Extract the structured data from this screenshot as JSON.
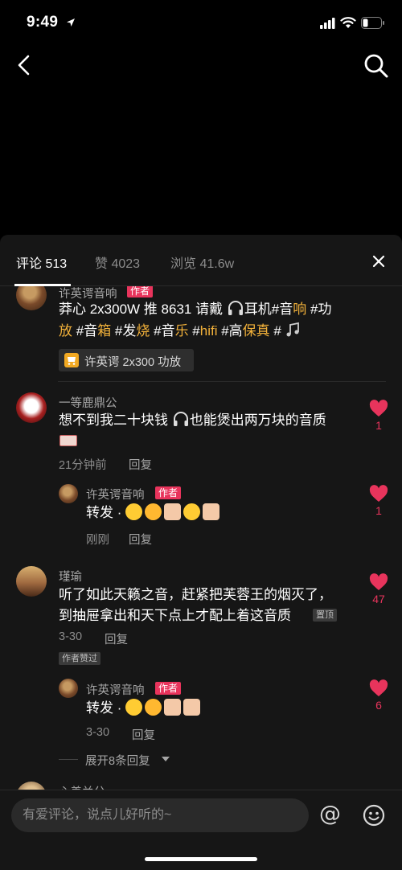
{
  "status_bar": {
    "time": "9:49"
  },
  "colors": {
    "accent": "#e8345c",
    "gold_text": "#f2b13a",
    "sheet_bg": "#161616"
  },
  "tabs": [
    {
      "label": "评论 513",
      "active": true
    },
    {
      "label": "赞 4023",
      "active": false
    },
    {
      "label": "浏览 41.6w",
      "active": false
    }
  ],
  "comments": {
    "c0": {
      "username": "许英谔音响",
      "badge": "作者",
      "line1": [
        "莽心 2x300W 推 8631 请戴",
        "耳机#音",
        "响",
        " #功"
      ],
      "line2": [
        "放",
        " #音",
        "箱",
        " #发",
        "烧",
        " #音",
        "乐",
        " #",
        "hifi",
        " #高",
        "保真",
        " #"
      ],
      "product": "许英谔 2x300 功放"
    },
    "c1": {
      "username": "一等鹿鼎公",
      "text_a": "想不到我二十块钱",
      "text_b": "也能煲出两万块的音质",
      "time": "21分钟前",
      "reply": "回复",
      "likes": "1"
    },
    "c1r": {
      "username": "许英谔音响",
      "badge": "作者",
      "text": "转发 ·",
      "time": "刚刚",
      "reply": "回复",
      "likes": "1"
    },
    "c2": {
      "username": "瑾瑜",
      "line1": "听了如此天籁之音，赶紧把芙蓉王的烟灭了，",
      "line2": "到抽屉拿出和天下点上才配上着这音质",
      "pinned": "置顶",
      "time": "3-30",
      "reply": "回复",
      "author_liked": "作者赞过",
      "likes": "47"
    },
    "c2r": {
      "username": "许英谔音响",
      "badge": "作者",
      "text": "转发 ·",
      "time": "3-30",
      "reply": "回复",
      "likes": "6"
    },
    "expand": "展开8条回复",
    "c3": {
      "username": "心善兰分"
    }
  },
  "input": {
    "placeholder": "有爱评论，说点儿好听的~"
  },
  "icons": [
    "back-arrow-icon",
    "search-icon",
    "close-icon",
    "heart-icon",
    "at-icon",
    "emoji-face-icon",
    "cart-icon",
    "headphones-icon"
  ]
}
